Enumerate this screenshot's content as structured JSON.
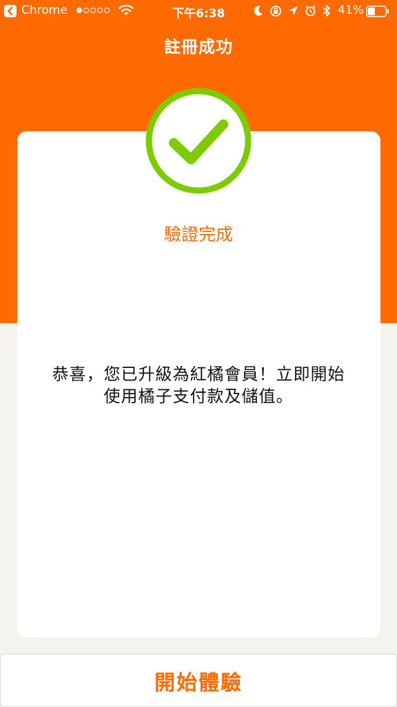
{
  "status_bar": {
    "app_name": "Chrome",
    "time": "下午6:38",
    "battery_percent": "41%",
    "signal_bars_filled": 1,
    "signal_bars_total": 5,
    "battery_level": 0.41
  },
  "header": {
    "title": "註冊成功"
  },
  "card": {
    "verify_label": "驗證完成",
    "message_line1": "恭喜，您已升級為紅橘會員！立即開始",
    "message_line2": "使用橘子支付款及儲值。"
  },
  "footer": {
    "start_button_label": "開始體驗"
  },
  "colors": {
    "brand_orange": "#ff6a00",
    "check_green": "#7ccc00",
    "page_background": "#f5f3ee"
  },
  "icons": {
    "back": "back-icon",
    "wifi": "wifi-icon",
    "moon": "moon-icon",
    "rotation_lock": "rotation-lock-icon",
    "location": "location-arrow-icon",
    "alarm": "alarm-icon",
    "bluetooth": "bluetooth-icon",
    "battery": "battery-icon",
    "success": "checkmark-icon"
  }
}
